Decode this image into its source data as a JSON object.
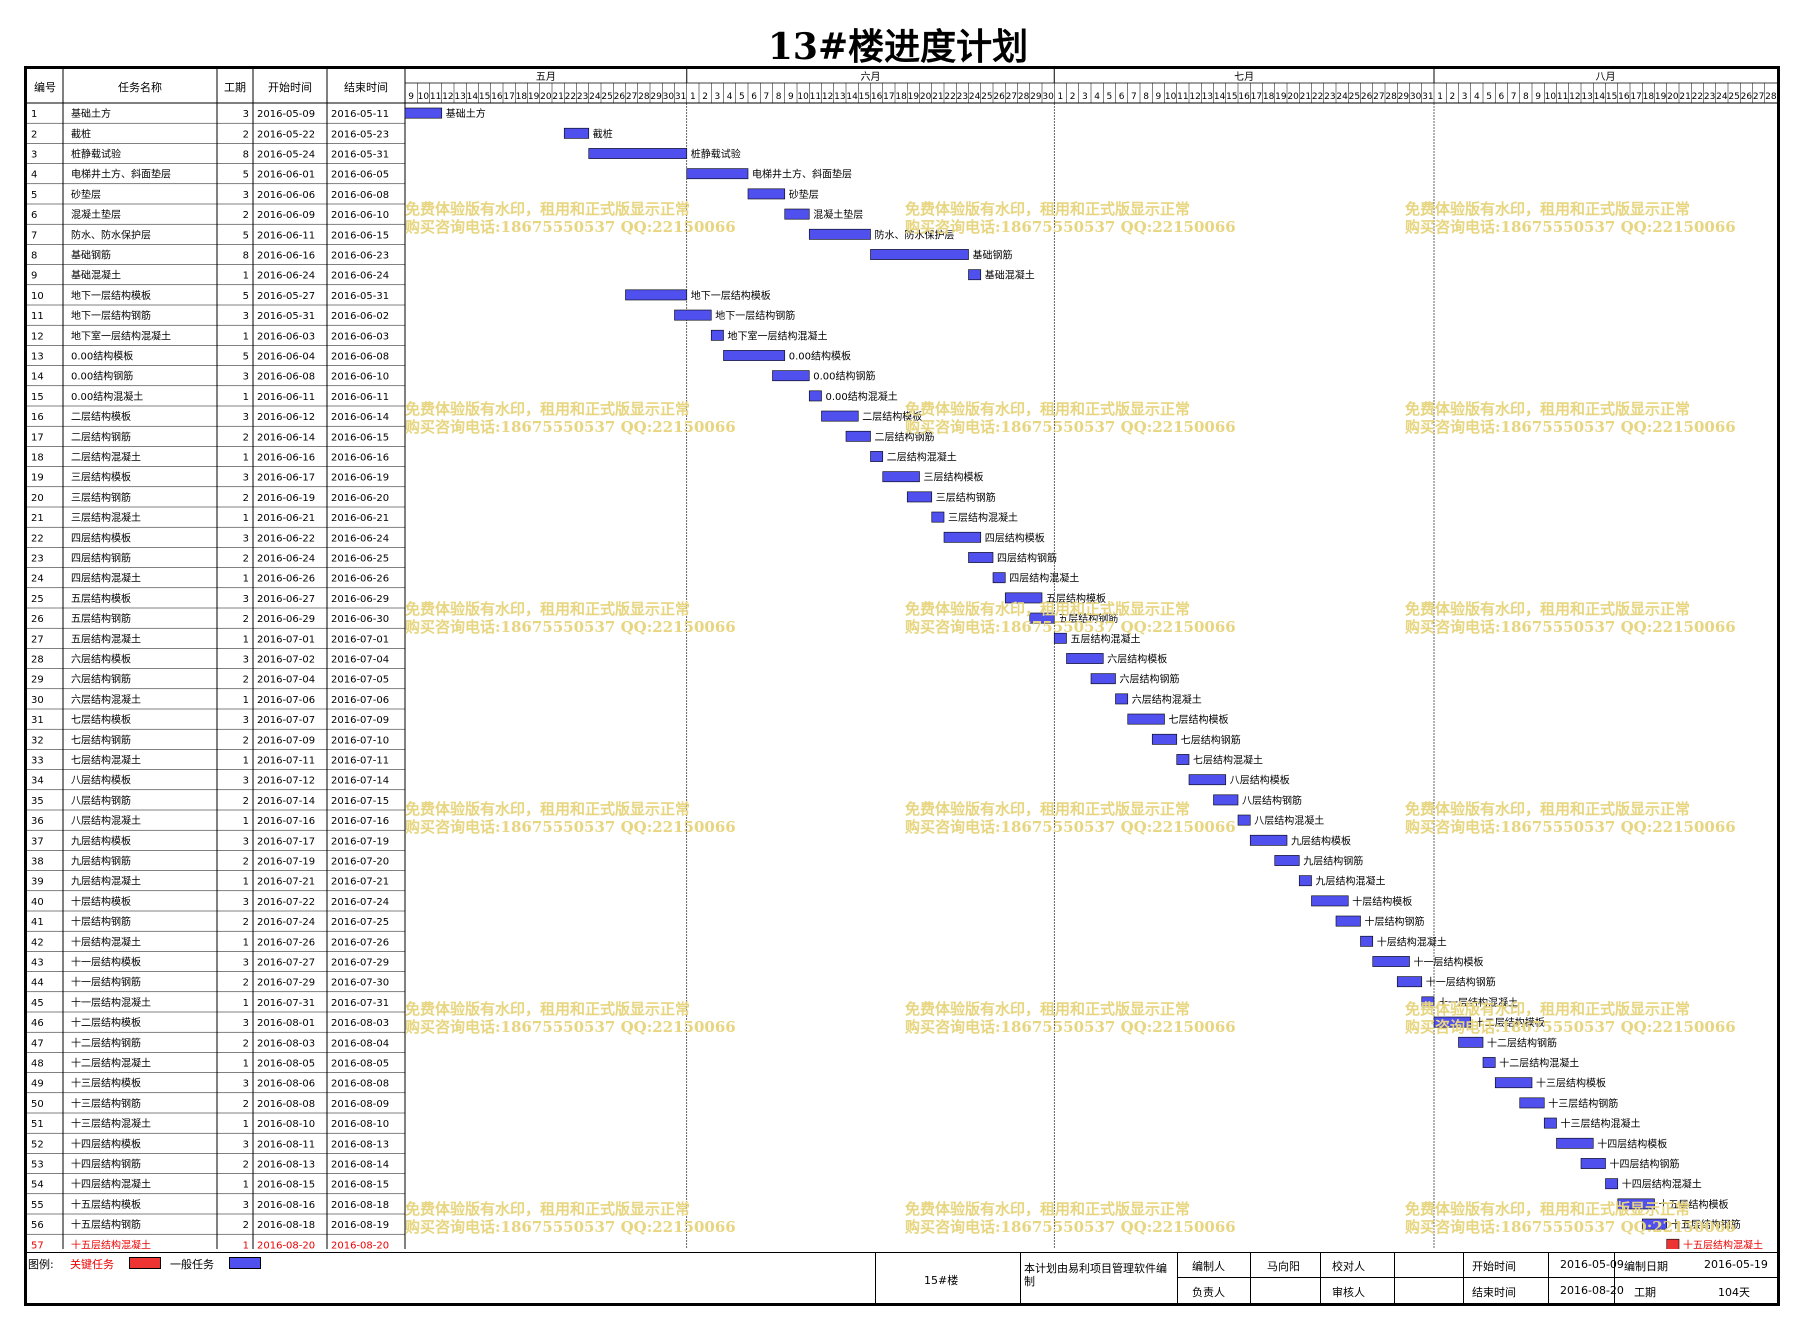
{
  "title": "13#楼进度计划",
  "table": {
    "headers": {
      "id": "编号",
      "name": "任务名称",
      "duration": "工期",
      "start": "开始时间",
      "end": "结束时间"
    }
  },
  "timeline": {
    "months": [
      {
        "label": "五月",
        "start": "2016-05-09",
        "days": [
          9,
          10,
          11,
          12,
          13,
          14,
          15,
          16,
          17,
          18,
          19,
          20,
          21,
          22,
          23,
          24,
          25,
          26,
          27,
          28,
          29,
          30,
          31
        ]
      },
      {
        "label": "六月",
        "start": "2016-06-01",
        "days": [
          1,
          2,
          3,
          4,
          5,
          6,
          7,
          8,
          9,
          10,
          11,
          12,
          13,
          14,
          15,
          16,
          17,
          18,
          19,
          20,
          21,
          22,
          23,
          24,
          25,
          26,
          27,
          28,
          29,
          30
        ]
      },
      {
        "label": "七月",
        "start": "2016-07-01",
        "days": [
          1,
          2,
          3,
          4,
          5,
          6,
          7,
          8,
          9,
          10,
          11,
          12,
          13,
          14,
          15,
          16,
          17,
          18,
          19,
          20,
          21,
          22,
          23,
          24,
          25,
          26,
          27,
          28,
          29,
          30,
          31
        ]
      },
      {
        "label": "八月",
        "start": "2016-08-01",
        "days": [
          1,
          2,
          3,
          4,
          5,
          6,
          7,
          8,
          9,
          10,
          11,
          12,
          13,
          14,
          15,
          16,
          17,
          18,
          19,
          20,
          21,
          22,
          23,
          24,
          25,
          26,
          27,
          28
        ]
      }
    ],
    "range_start": "2016-05-09",
    "range_end": "2016-08-28"
  },
  "colors": {
    "normal_fill": "#5050ee",
    "critical_fill": "#ee3333",
    "critical_text": "#ee0000",
    "watermark": "#e7d580"
  },
  "watermark_lines": [
    "免费体验版有水印，租用和正式版显示正常",
    "购买咨询电话:18675550537 QQ:22150066"
  ],
  "chart_data": {
    "type": "gantt",
    "tasks": [
      {
        "id": 1,
        "name": "基础土方",
        "duration": 3,
        "start": "2016-05-09",
        "end": "2016-05-11",
        "critical": false
      },
      {
        "id": 2,
        "name": "截桩",
        "duration": 2,
        "start": "2016-05-22",
        "end": "2016-05-23",
        "critical": false
      },
      {
        "id": 3,
        "name": "桩静载试验",
        "duration": 8,
        "start": "2016-05-24",
        "end": "2016-05-31",
        "critical": false
      },
      {
        "id": 4,
        "name": "电梯井土方、斜面垫层",
        "duration": 5,
        "start": "2016-06-01",
        "end": "2016-06-05",
        "critical": false
      },
      {
        "id": 5,
        "name": "砂垫层",
        "duration": 3,
        "start": "2016-06-06",
        "end": "2016-06-08",
        "critical": false
      },
      {
        "id": 6,
        "name": "混凝土垫层",
        "duration": 2,
        "start": "2016-06-09",
        "end": "2016-06-10",
        "critical": false
      },
      {
        "id": 7,
        "name": "防水、防水保护层",
        "duration": 5,
        "start": "2016-06-11",
        "end": "2016-06-15",
        "critical": false
      },
      {
        "id": 8,
        "name": "基础钢筋",
        "duration": 8,
        "start": "2016-06-16",
        "end": "2016-06-23",
        "critical": false
      },
      {
        "id": 9,
        "name": "基础混凝土",
        "duration": 1,
        "start": "2016-06-24",
        "end": "2016-06-24",
        "critical": false
      },
      {
        "id": 10,
        "name": "地下一层结构模板",
        "duration": 5,
        "start": "2016-05-27",
        "end": "2016-05-31",
        "critical": false
      },
      {
        "id": 11,
        "name": "地下一层结构钢筋",
        "duration": 3,
        "start": "2016-05-31",
        "end": "2016-06-02",
        "critical": false
      },
      {
        "id": 12,
        "name": "地下室一层结构混凝土",
        "duration": 1,
        "start": "2016-06-03",
        "end": "2016-06-03",
        "critical": false
      },
      {
        "id": 13,
        "name": "0.00结构模板",
        "duration": 5,
        "start": "2016-06-04",
        "end": "2016-06-08",
        "critical": false
      },
      {
        "id": 14,
        "name": "0.00结构钢筋",
        "duration": 3,
        "start": "2016-06-08",
        "end": "2016-06-10",
        "critical": false
      },
      {
        "id": 15,
        "name": "0.00结构混凝土",
        "duration": 1,
        "start": "2016-06-11",
        "end": "2016-06-11",
        "critical": false
      },
      {
        "id": 16,
        "name": "二层结构模板",
        "duration": 3,
        "start": "2016-06-12",
        "end": "2016-06-14",
        "critical": false
      },
      {
        "id": 17,
        "name": "二层结构钢筋",
        "duration": 2,
        "start": "2016-06-14",
        "end": "2016-06-15",
        "critical": false
      },
      {
        "id": 18,
        "name": "二层结构混凝土",
        "duration": 1,
        "start": "2016-06-16",
        "end": "2016-06-16",
        "critical": false
      },
      {
        "id": 19,
        "name": "三层结构模板",
        "duration": 3,
        "start": "2016-06-17",
        "end": "2016-06-19",
        "critical": false
      },
      {
        "id": 20,
        "name": "三层结构钢筋",
        "duration": 2,
        "start": "2016-06-19",
        "end": "2016-06-20",
        "critical": false
      },
      {
        "id": 21,
        "name": "三层结构混凝土",
        "duration": 1,
        "start": "2016-06-21",
        "end": "2016-06-21",
        "critical": false
      },
      {
        "id": 22,
        "name": "四层结构模板",
        "duration": 3,
        "start": "2016-06-22",
        "end": "2016-06-24",
        "critical": false
      },
      {
        "id": 23,
        "name": "四层结构钢筋",
        "duration": 2,
        "start": "2016-06-24",
        "end": "2016-06-25",
        "critical": false
      },
      {
        "id": 24,
        "name": "四层结构混凝土",
        "duration": 1,
        "start": "2016-06-26",
        "end": "2016-06-26",
        "critical": false
      },
      {
        "id": 25,
        "name": "五层结构模板",
        "duration": 3,
        "start": "2016-06-27",
        "end": "2016-06-29",
        "critical": false
      },
      {
        "id": 26,
        "name": "五层结构钢筋",
        "duration": 2,
        "start": "2016-06-29",
        "end": "2016-06-30",
        "critical": false
      },
      {
        "id": 27,
        "name": "五层结构混凝土",
        "duration": 1,
        "start": "2016-07-01",
        "end": "2016-07-01",
        "critical": false
      },
      {
        "id": 28,
        "name": "六层结构模板",
        "duration": 3,
        "start": "2016-07-02",
        "end": "2016-07-04",
        "critical": false
      },
      {
        "id": 29,
        "name": "六层结构钢筋",
        "duration": 2,
        "start": "2016-07-04",
        "end": "2016-07-05",
        "critical": false
      },
      {
        "id": 30,
        "name": "六层结构混凝土",
        "duration": 1,
        "start": "2016-07-06",
        "end": "2016-07-06",
        "critical": false
      },
      {
        "id": 31,
        "name": "七层结构模板",
        "duration": 3,
        "start": "2016-07-07",
        "end": "2016-07-09",
        "critical": false
      },
      {
        "id": 32,
        "name": "七层结构钢筋",
        "duration": 2,
        "start": "2016-07-09",
        "end": "2016-07-10",
        "critical": false
      },
      {
        "id": 33,
        "name": "七层结构混凝土",
        "duration": 1,
        "start": "2016-07-11",
        "end": "2016-07-11",
        "critical": false
      },
      {
        "id": 34,
        "name": "八层结构模板",
        "duration": 3,
        "start": "2016-07-12",
        "end": "2016-07-14",
        "critical": false
      },
      {
        "id": 35,
        "name": "八层结构钢筋",
        "duration": 2,
        "start": "2016-07-14",
        "end": "2016-07-15",
        "critical": false
      },
      {
        "id": 36,
        "name": "八层结构混凝土",
        "duration": 1,
        "start": "2016-07-16",
        "end": "2016-07-16",
        "critical": false
      },
      {
        "id": 37,
        "name": "九层结构模板",
        "duration": 3,
        "start": "2016-07-17",
        "end": "2016-07-19",
        "critical": false
      },
      {
        "id": 38,
        "name": "九层结构钢筋",
        "duration": 2,
        "start": "2016-07-19",
        "end": "2016-07-20",
        "critical": false
      },
      {
        "id": 39,
        "name": "九层结构混凝土",
        "duration": 1,
        "start": "2016-07-21",
        "end": "2016-07-21",
        "critical": false
      },
      {
        "id": 40,
        "name": "十层结构模板",
        "duration": 3,
        "start": "2016-07-22",
        "end": "2016-07-24",
        "critical": false
      },
      {
        "id": 41,
        "name": "十层结构钢筋",
        "duration": 2,
        "start": "2016-07-24",
        "end": "2016-07-25",
        "critical": false
      },
      {
        "id": 42,
        "name": "十层结构混凝土",
        "duration": 1,
        "start": "2016-07-26",
        "end": "2016-07-26",
        "critical": false
      },
      {
        "id": 43,
        "name": "十一层结构模板",
        "duration": 3,
        "start": "2016-07-27",
        "end": "2016-07-29",
        "critical": false
      },
      {
        "id": 44,
        "name": "十一层结构钢筋",
        "duration": 2,
        "start": "2016-07-29",
        "end": "2016-07-30",
        "critical": false
      },
      {
        "id": 45,
        "name": "十一层结构混凝土",
        "duration": 1,
        "start": "2016-07-31",
        "end": "2016-07-31",
        "critical": false
      },
      {
        "id": 46,
        "name": "十二层结构模板",
        "duration": 3,
        "start": "2016-08-01",
        "end": "2016-08-03",
        "critical": false
      },
      {
        "id": 47,
        "name": "十二层结构钢筋",
        "duration": 2,
        "start": "2016-08-03",
        "end": "2016-08-04",
        "critical": false
      },
      {
        "id": 48,
        "name": "十二层结构混凝土",
        "duration": 1,
        "start": "2016-08-05",
        "end": "2016-08-05",
        "critical": false
      },
      {
        "id": 49,
        "name": "十三层结构模板",
        "duration": 3,
        "start": "2016-08-06",
        "end": "2016-08-08",
        "critical": false
      },
      {
        "id": 50,
        "name": "十三层结构钢筋",
        "duration": 2,
        "start": "2016-08-08",
        "end": "2016-08-09",
        "critical": false
      },
      {
        "id": 51,
        "name": "十三层结构混凝土",
        "duration": 1,
        "start": "2016-08-10",
        "end": "2016-08-10",
        "critical": false
      },
      {
        "id": 52,
        "name": "十四层结构模板",
        "duration": 3,
        "start": "2016-08-11",
        "end": "2016-08-13",
        "critical": false
      },
      {
        "id": 53,
        "name": "十四层结构钢筋",
        "duration": 2,
        "start": "2016-08-13",
        "end": "2016-08-14",
        "critical": false
      },
      {
        "id": 54,
        "name": "十四层结构混凝土",
        "duration": 1,
        "start": "2016-08-15",
        "end": "2016-08-15",
        "critical": false
      },
      {
        "id": 55,
        "name": "十五层结构模板",
        "duration": 3,
        "start": "2016-08-16",
        "end": "2016-08-18",
        "critical": false
      },
      {
        "id": 56,
        "name": "十五层结构钢筋",
        "duration": 2,
        "start": "2016-08-18",
        "end": "2016-08-19",
        "critical": false
      },
      {
        "id": 57,
        "name": "十五层结构混凝土",
        "duration": 1,
        "start": "2016-08-20",
        "end": "2016-08-20",
        "critical": true
      }
    ]
  },
  "footer": {
    "legend_label": "图例:",
    "critical_label": "关键任务",
    "normal_label": "一般任务",
    "project": "15#楼",
    "note": "本计划由易利项目管理软件编制",
    "compiler_label": "编制人",
    "compiler": "马向阳",
    "checker_label": "校对人",
    "checker": "",
    "responsible_label": "负责人",
    "responsible": "",
    "reviewer_label": "审核人",
    "reviewer": "",
    "start_label": "开始时间",
    "start": "2016-05-09",
    "end_label": "结束时间",
    "end": "2016-08-20",
    "date_label": "编制日期",
    "date": "2016-05-19",
    "duration_label": "工期",
    "duration": "104天"
  }
}
